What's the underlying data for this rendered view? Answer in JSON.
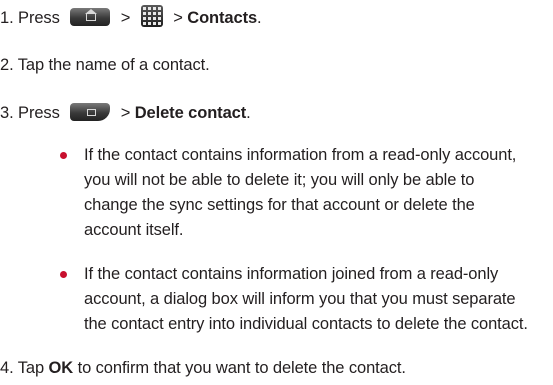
{
  "steps": {
    "step1": {
      "prefix": "1. Press",
      "sep1": ">",
      "sep2": ">",
      "target": "Contacts",
      "end": ".",
      "icons": [
        "home-key-icon",
        "apps-grid-icon"
      ]
    },
    "step2": {
      "text": "2. Tap the name of a contact."
    },
    "step3": {
      "prefix": "3. Press",
      "sep": ">",
      "target": "Delete contact",
      "end": ".",
      "icons": [
        "menu-key-icon"
      ]
    },
    "bullets": [
      {
        "lines": [
          "If the contact contains information from a read-only account,",
          "you will not be able to delete it; you will only be able to",
          "change the sync settings for that account or delete the",
          "account itself."
        ]
      },
      {
        "lines": [
          "If the contact contains information joined from a read-only",
          "account, a dialog box will inform you that you must separate",
          "the contact entry into individual contacts to delete the contact."
        ]
      }
    ],
    "step4": {
      "prefix": "4. Tap",
      "bold": "OK",
      "suffix": "to confirm that you want to delete the contact."
    }
  },
  "colors": {
    "text": "#231f20",
    "bullet": "#c8102e"
  }
}
